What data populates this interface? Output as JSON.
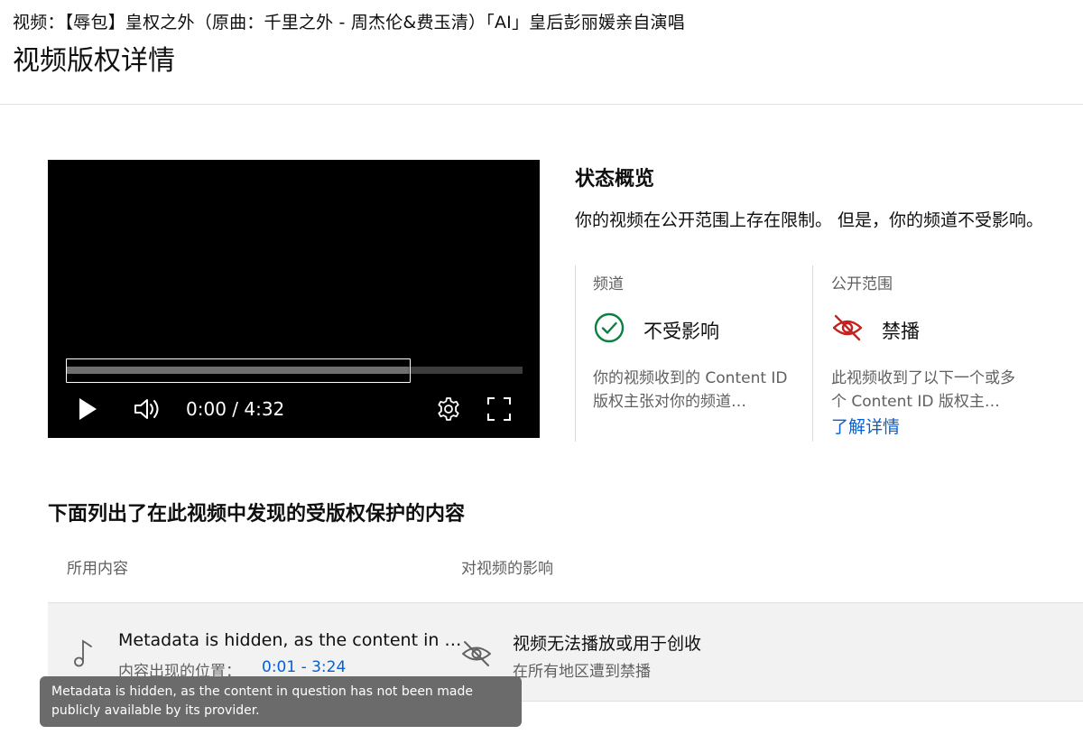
{
  "header": {
    "video_title": "视频：【辱包】皇权之外（原曲：千里之外 - 周杰伦&费玉清）「AI」皇后彭丽媛亲自演唱",
    "page_title": "视频版权详情"
  },
  "player": {
    "time_display": "0:00 / 4:32",
    "buffered_fraction": 0.75,
    "icons": [
      "play-icon",
      "volume-icon",
      "settings-gear-icon",
      "fullscreen-icon"
    ]
  },
  "status": {
    "title": "状态概览",
    "summary": "你的视频在公开范围上存在限制。 但是，你的频道不受影响。",
    "channel": {
      "label": "频道",
      "value": "不受影响",
      "description": "你的视频收到的 Content ID 版权主张对你的频道…",
      "icon": "check-circle-icon",
      "color": "#0b8043"
    },
    "visibility": {
      "label": "公开范围",
      "value": "禁播",
      "description": "此视频收到了以下一个或多个 Content ID 版权主…",
      "learn_more": "了解详情",
      "icon": "eye-off-icon",
      "color": "#c5221f"
    }
  },
  "content_list": {
    "heading": "下面列出了在此视频中发现的受版权保护的内容",
    "columns": [
      "所用内容",
      "对视频的影响"
    ],
    "rows": [
      {
        "title": "Metadata is hidden, as the content in …",
        "position_label": "内容出现的位置：",
        "position_range": "0:01 - 3:24",
        "impact_title": "视频无法播放或用于创收",
        "impact_sub": "在所有地区遭到禁播",
        "icon": "music-note-icon",
        "impact_icon": "eye-off-icon"
      }
    ]
  },
  "tooltip": {
    "text": "Metadata is hidden, as the content in question has not been made publicly available by its provider."
  },
  "colors": {
    "link": "#065fd4",
    "secondary_text": "#606060",
    "row_background": "#f2f2f2",
    "tooltip_background": "#6b6b6b"
  }
}
